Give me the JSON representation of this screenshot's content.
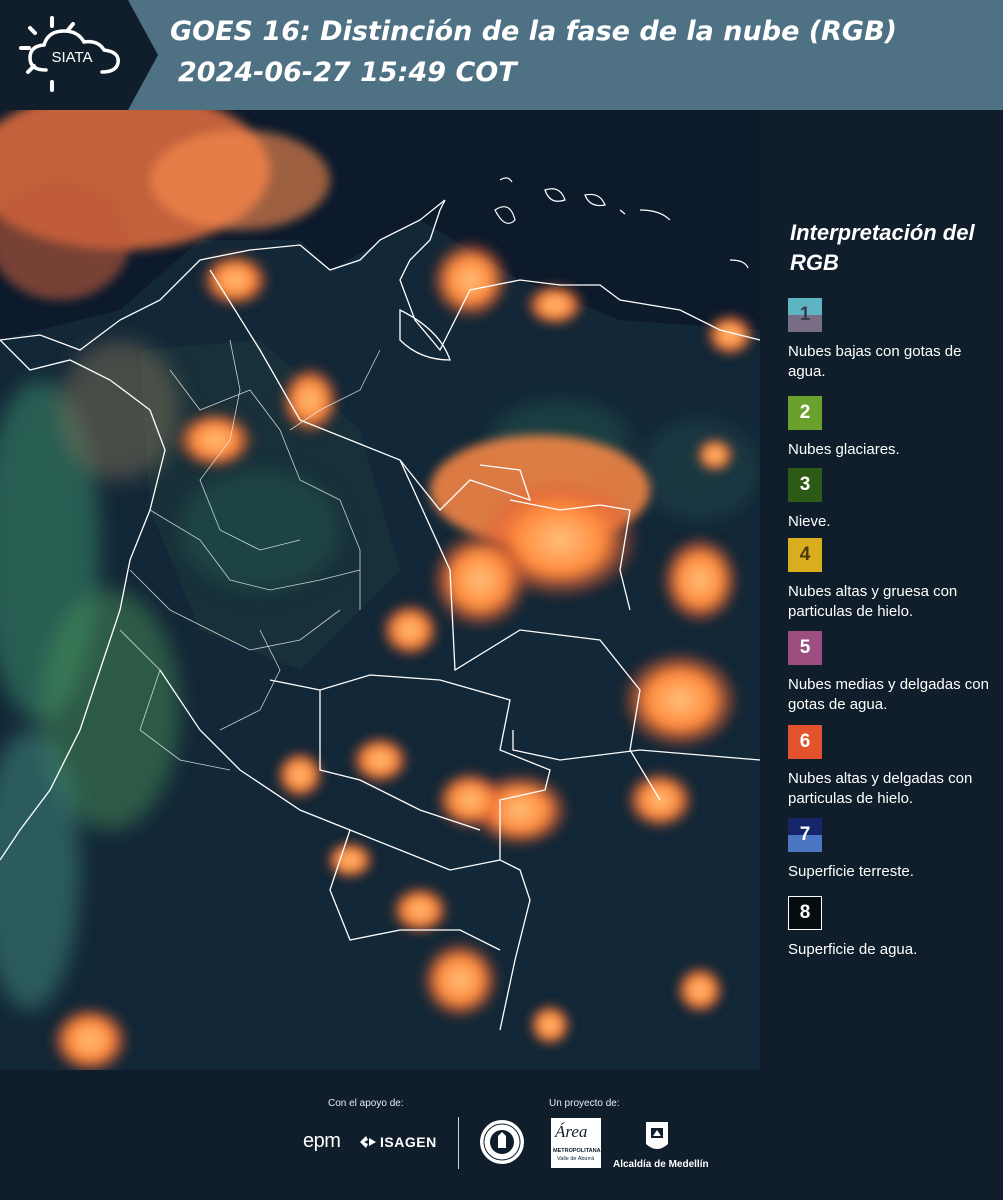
{
  "header": {
    "logo_text": "SIATA",
    "title": "GOES 16: Distinción de la fase de la nube (RGB)",
    "subtitle": "2024-06-27 15:49 COT",
    "color": "#4e7184"
  },
  "legend": {
    "title": "Interpretación del RGB",
    "items": [
      {
        "number": "1",
        "label": "Nubes bajas con gotas de agua.",
        "top_color": "#5fb4c4",
        "bottom_color": "#786c86",
        "number_color": "#3b3b4a"
      },
      {
        "number": "2",
        "label": "Nubes glaciares.",
        "top_color": "#6aa12c",
        "bottom_color": "#6aa12c",
        "number_color": "#ffffff"
      },
      {
        "number": "3",
        "label": "Nieve.",
        "top_color": "#2e5a17",
        "bottom_color": "#2e5a17",
        "number_color": "#ffffff"
      },
      {
        "number": "4",
        "label": "Nubes altas y gruesa con particulas de hielo.",
        "top_color": "#d9ad1e",
        "bottom_color": "#d9ad1e",
        "number_color": "#4a3a10"
      },
      {
        "number": "5",
        "label": "Nubes medias y delgadas con gotas de agua.",
        "top_color": "#9c4e80",
        "bottom_color": "#9c4e80",
        "number_color": "#ffffff"
      },
      {
        "number": "6",
        "label": "Nubes altas y delgadas con particulas de hielo.",
        "top_color": "#e2532d",
        "bottom_color": "#e2532d",
        "number_color": "#ffffff"
      },
      {
        "number": "7",
        "label": "Superficie terreste.",
        "top_color": "#16256a",
        "bottom_color": "#4b76c4",
        "number_color": "#ffffff"
      },
      {
        "number": "8",
        "label": "Superficie de agua.",
        "top_color": "#060d10",
        "bottom_color": "#060d10",
        "number_color": "#ffffff"
      }
    ]
  },
  "footer": {
    "support_label": "Con el apoyo de:",
    "project_label": "Un proyecto de:",
    "sponsors": [
      "epm",
      "ISAGEN"
    ],
    "partners": {
      "area_name": "Área",
      "area_line1": "METROPOLITANA",
      "area_line2": "Valle de Aburrá",
      "alcaldia": "Alcaldía de Medellín"
    }
  }
}
